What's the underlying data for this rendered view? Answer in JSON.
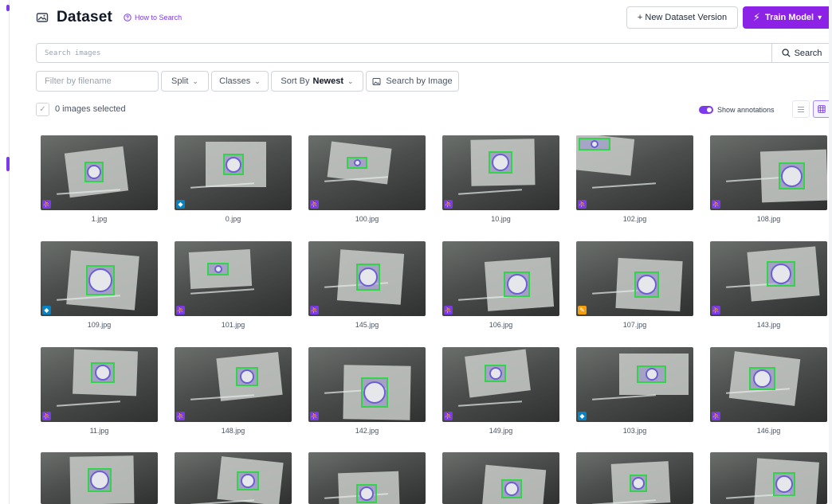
{
  "header": {
    "title": "Dataset",
    "title_icon": "image-gallery-icon",
    "how_to_search": "How to Search",
    "new_version_label": "+ New Dataset Version",
    "train_model_label": "Train Model"
  },
  "search": {
    "placeholder": "Search images",
    "button_label": "Search"
  },
  "filters": {
    "filename_placeholder": "Filter by filename",
    "split_label": "Split",
    "classes_label": "Classes",
    "sort_prefix": "Sort By",
    "sort_value": "Newest",
    "search_by_image_label": "Search by Image"
  },
  "selection": {
    "count_label": "0 images selected",
    "show_annotations_label": "Show annotations",
    "show_annotations_on": true
  },
  "colors": {
    "accent": "#8b22e6",
    "train_badge": "#7c3aed",
    "valid_badge": "#0284c7",
    "test_badge": "#f59e0b",
    "bbox": "#34d34a"
  },
  "images": [
    {
      "name": "1.jpg",
      "split": "train"
    },
    {
      "name": "0.jpg",
      "split": "valid"
    },
    {
      "name": "100.jpg",
      "split": "train"
    },
    {
      "name": "10.jpg",
      "split": "train"
    },
    {
      "name": "102.jpg",
      "split": "train"
    },
    {
      "name": "108.jpg",
      "split": "train"
    },
    {
      "name": "109.jpg",
      "split": "valid"
    },
    {
      "name": "101.jpg",
      "split": "train"
    },
    {
      "name": "145.jpg",
      "split": "train"
    },
    {
      "name": "106.jpg",
      "split": "train"
    },
    {
      "name": "107.jpg",
      "split": "test"
    },
    {
      "name": "143.jpg",
      "split": "train"
    },
    {
      "name": "11.jpg",
      "split": "train"
    },
    {
      "name": "148.jpg",
      "split": "train"
    },
    {
      "name": "142.jpg",
      "split": "train"
    },
    {
      "name": "149.jpg",
      "split": "train"
    },
    {
      "name": "103.jpg",
      "split": "valid"
    },
    {
      "name": "146.jpg",
      "split": "train"
    },
    {
      "name": "",
      "split": ""
    },
    {
      "name": "",
      "split": ""
    },
    {
      "name": "",
      "split": ""
    },
    {
      "name": "",
      "split": ""
    },
    {
      "name": "",
      "split": ""
    },
    {
      "name": "",
      "split": ""
    }
  ]
}
